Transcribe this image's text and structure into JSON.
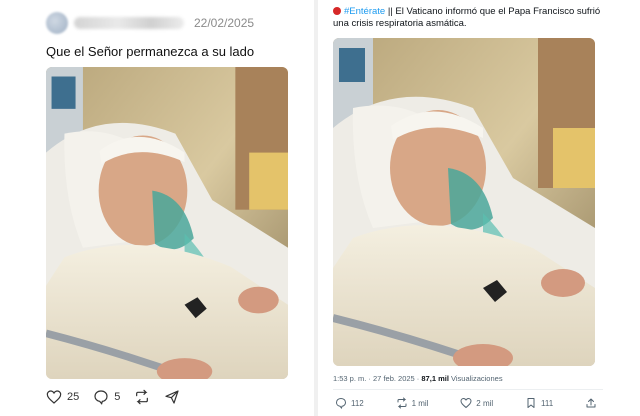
{
  "left_post": {
    "date": "22/02/2025",
    "text": "Que el Señor permanezca a su lado",
    "likes": "25",
    "replies": "5"
  },
  "right_post": {
    "hashtag": "#Entérate",
    "headline": " || El Vaticano informó que el Papa Francisco sufrió una crisis respiratoria asmática.",
    "timestamp": "1:53 p. m. · 27 feb. 2025 · ",
    "views_count": "87,1 mil",
    "views_label": " Visualizaciones",
    "replies": "112",
    "reposts": "1 mil",
    "likes": "2 mil",
    "bookmarks": "111"
  },
  "colors": {
    "accent": "#1d9bf0",
    "alert_dot": "#d62828"
  },
  "icons": [
    "heart-icon",
    "reply-icon",
    "repost-icon",
    "share-icon",
    "bookmark-icon",
    "upload-icon"
  ]
}
